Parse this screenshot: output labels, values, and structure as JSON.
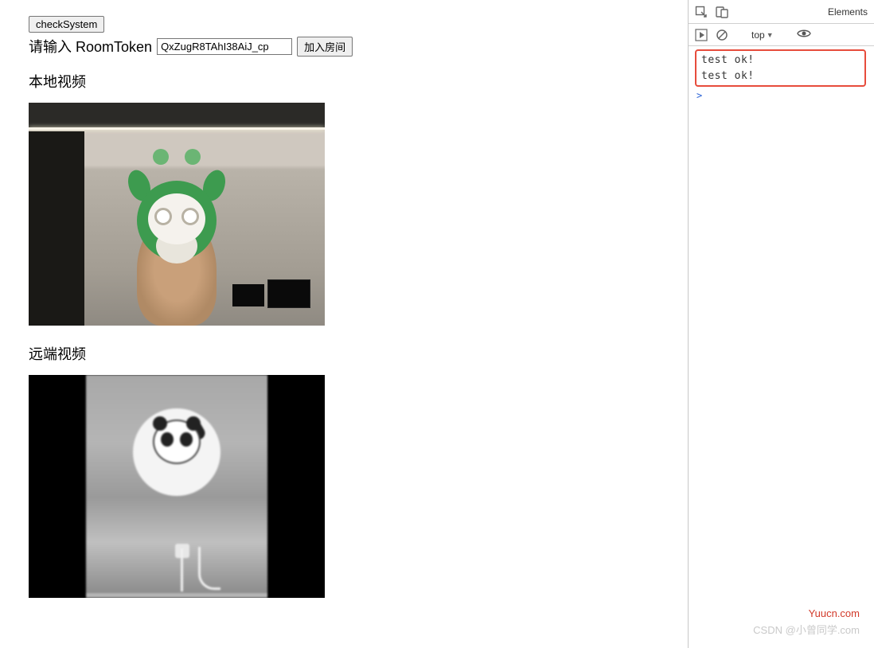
{
  "main": {
    "check_system_btn": "checkSystem",
    "room_token_label": "请输入 RoomToken",
    "room_token_value": "QxZugR8TAhI38AiJ_cp",
    "join_room_btn": "加入房间",
    "local_video_title": "本地视频",
    "remote_video_title": "远端视频"
  },
  "devtools": {
    "tab_elements": "Elements",
    "context_dropdown": "top",
    "console_logs": [
      "test ok!",
      "test ok!"
    ],
    "prompt": ">"
  },
  "watermarks": {
    "site": "Yuucn.com",
    "author": "CSDN @小曾同学.com"
  },
  "icons": {
    "inspect": "inspect-icon",
    "device": "device-toggle-icon",
    "play": "play-icon",
    "clear": "clear-icon",
    "eye": "eye-icon",
    "dropdown": "dropdown-triangle-icon"
  }
}
